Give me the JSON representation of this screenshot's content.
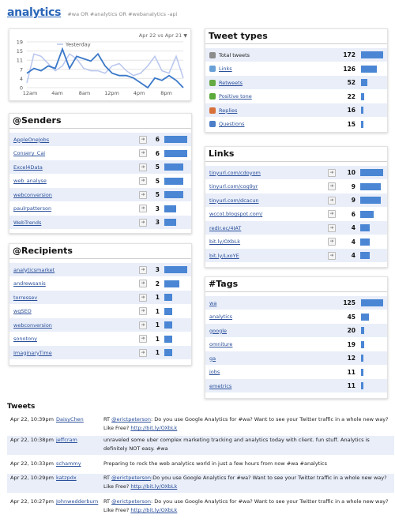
{
  "header": {
    "title": "analytics",
    "query": "#wa OR #analytics OR #webanalytics -api"
  },
  "chart": {
    "date_range": "Apr 22 vs Apr 21",
    "legend": "Yesterday",
    "y_ticks": [
      "19",
      "15",
      "11",
      "7",
      "4",
      "0"
    ],
    "x_ticks": [
      "12am",
      "4am",
      "8am",
      "12pm",
      "4pm",
      "8pm"
    ]
  },
  "chart_data": {
    "type": "line",
    "ylim": [
      0,
      19
    ],
    "x": [
      0,
      1,
      2,
      3,
      4,
      5,
      6,
      7,
      8,
      9,
      10,
      11,
      12,
      13,
      14,
      15,
      16,
      17,
      18,
      19,
      20,
      21,
      22
    ],
    "series": [
      {
        "name": "",
        "values": [
          6,
          8,
          7,
          9,
          8,
          16,
          8,
          13,
          12,
          11,
          14,
          9,
          6,
          5,
          5,
          4,
          2,
          0,
          4,
          3,
          5,
          3,
          0
        ]
      },
      {
        "name": "Yesterday",
        "values": [
          2,
          14,
          13,
          10,
          7,
          9,
          14,
          12,
          8,
          7,
          7,
          6,
          9,
          10,
          7,
          5,
          6,
          9,
          13,
          7,
          6,
          13,
          4
        ]
      }
    ],
    "colors": [
      "#3a78c9",
      "#b8c6ee"
    ]
  },
  "tweet_types": {
    "title": "Tweet types",
    "rows": [
      {
        "label": "Total tweets",
        "value": "172",
        "frac": 1.0,
        "icon": "total-icon",
        "color": "#8c8c8c"
      },
      {
        "label": "Links",
        "value": "126",
        "frac": 0.73,
        "icon": "link-icon",
        "color": "#6aa0d8"
      },
      {
        "label": "Retweets",
        "value": "52",
        "frac": 0.3,
        "icon": "retweet-icon",
        "color": "#66aa44"
      },
      {
        "label": "Positive tone",
        "value": "22",
        "frac": 0.13,
        "icon": "positive-icon",
        "color": "#5aa93a"
      },
      {
        "label": "Replies",
        "value": "16",
        "frac": 0.09,
        "icon": "reply-icon",
        "color": "#d8703a"
      },
      {
        "label": "Questions",
        "value": "15",
        "frac": 0.09,
        "icon": "question-icon",
        "color": "#4d7fc8"
      }
    ]
  },
  "senders": {
    "title": "@Senders",
    "rows": [
      {
        "label": "AppleOneJobs",
        "value": "6",
        "frac": 1.0
      },
      {
        "label": "Consery_Cai",
        "value": "6",
        "frac": 1.0
      },
      {
        "label": "Excel4Data",
        "value": "5",
        "frac": 0.83
      },
      {
        "label": "web_analyse",
        "value": "5",
        "frac": 0.83
      },
      {
        "label": "webconversion",
        "value": "5",
        "frac": 0.83
      },
      {
        "label": "paulrpatterson",
        "value": "3",
        "frac": 0.5
      },
      {
        "label": "WebTrends",
        "value": "3",
        "frac": 0.5
      }
    ]
  },
  "links": {
    "title": "Links",
    "rows": [
      {
        "label": "tinyurl.com/cdoyom",
        "value": "10",
        "frac": 1.0
      },
      {
        "label": "tinyurl.com/cog9yr",
        "value": "9",
        "frac": 0.9
      },
      {
        "label": "tinyurl.com/dcacun",
        "value": "9",
        "frac": 0.9
      },
      {
        "label": "wccot.blogspot.com/",
        "value": "6",
        "frac": 0.6
      },
      {
        "label": "redir.ec/4IAT",
        "value": "4",
        "frac": 0.4
      },
      {
        "label": "bit.ly/OXbLk",
        "value": "4",
        "frac": 0.4
      },
      {
        "label": "bit.ly/LxoYE",
        "value": "4",
        "frac": 0.4
      }
    ]
  },
  "recipients": {
    "title": "@Recipients",
    "rows": [
      {
        "label": "analyticsmarket",
        "value": "3",
        "frac": 1.0
      },
      {
        "label": "andrewsanis",
        "value": "2",
        "frac": 0.67
      },
      {
        "label": "torressev",
        "value": "1",
        "frac": 0.33
      },
      {
        "label": "wgSEO",
        "value": "1",
        "frac": 0.33
      },
      {
        "label": "webconversion",
        "value": "1",
        "frac": 0.33
      },
      {
        "label": "sonotony",
        "value": "1",
        "frac": 0.33
      },
      {
        "label": "ImaginaryTime",
        "value": "1",
        "frac": 0.33
      }
    ]
  },
  "tags": {
    "title": "#Tags",
    "rows": [
      {
        "label": "wa",
        "value": "125",
        "frac": 1.0
      },
      {
        "label": "analytics",
        "value": "45",
        "frac": 0.36
      },
      {
        "label": "google",
        "value": "20",
        "frac": 0.16
      },
      {
        "label": "omniture",
        "value": "19",
        "frac": 0.15
      },
      {
        "label": "ga",
        "value": "12",
        "frac": 0.1
      },
      {
        "label": "jobs",
        "value": "11",
        "frac": 0.09
      },
      {
        "label": "emetrics",
        "value": "11",
        "frac": 0.09
      }
    ]
  },
  "tweets": {
    "title": "Tweets",
    "items": [
      {
        "time": "Apr 22, 10:39pm",
        "user": "DaisyChen",
        "parts": [
          "RT ",
          "@erictpeterson",
          ": Do you use Google Analytics for #wa? Want to see your Twitter traffic in a whole new way? Like Free? ",
          "http://bit.ly/OXbLk"
        ]
      },
      {
        "time": "Apr 22, 10:38pm",
        "user": "jeffcram",
        "parts": [
          "unraveled some uber complex marketing tracking and analytics today with client. fun stuff. Analytics is definitely NOT easy. #wa",
          "",
          "",
          ""
        ]
      },
      {
        "time": "Apr 22, 10:33pm",
        "user": "schammy",
        "parts": [
          "Preparing to rock the web analytics world in just a few hours from now #wa #analytics",
          "",
          "",
          ""
        ]
      },
      {
        "time": "Apr 22, 10:29pm",
        "user": "katzpdx",
        "parts": [
          "RT ",
          "@erictpeterson",
          ":Do you use Google Analytics for #wa? Want to see your Twitter traffic in a whole new way? Like Free? ",
          "http://bit.ly/OXbLk"
        ]
      },
      {
        "time": "Apr 22, 10:27pm",
        "user": "Johnwedderburn",
        "parts": [
          "RT ",
          "@erictpeterson",
          ": Do you use Google Analytics for #wa? Want to see your Twitter traffic in a whole new way? Like Free? ",
          "http://bit.ly/OXbLk"
        ]
      }
    ]
  }
}
